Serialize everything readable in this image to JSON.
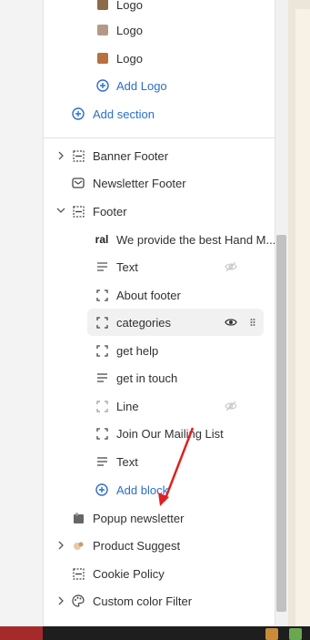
{
  "sidebar": {
    "logo_items": [
      {
        "label": "Logo"
      },
      {
        "label": "Logo"
      },
      {
        "label": "Logo"
      }
    ],
    "add_logo": "Add Logo",
    "add_section": "Add section",
    "sections": [
      {
        "label": "Banner Footer",
        "icon": "layout-icon"
      },
      {
        "label": "Newsletter Footer",
        "icon": "envelope-icon"
      },
      {
        "label": "Footer",
        "icon": "layout-icon"
      }
    ],
    "footer_blocks": [
      {
        "label": "We provide the best Hand M...",
        "icon": "heading-icon",
        "icon_text": "ral"
      },
      {
        "label": "Text",
        "icon": "text-icon"
      },
      {
        "label": "About footer",
        "icon": "dashed-square-icon"
      },
      {
        "label": "categories",
        "icon": "dashed-square-icon"
      },
      {
        "label": "get help",
        "icon": "dashed-square-icon"
      },
      {
        "label": "get in touch",
        "icon": "text-icon"
      },
      {
        "label": "Line",
        "icon": "dashed-square-icon"
      },
      {
        "label": "Join Our Mailing List",
        "icon": "dashed-square-icon"
      },
      {
        "label": "Text",
        "icon": "text-icon"
      }
    ],
    "add_block": "Add block",
    "bottom_sections": [
      {
        "label": "Popup newsletter",
        "icon": "popup-icon"
      },
      {
        "label": "Product Suggest",
        "icon": "product-icon"
      },
      {
        "label": "Cookie Policy",
        "icon": "layout-icon"
      },
      {
        "label": "Custom color Filter",
        "icon": "palette-icon"
      }
    ]
  },
  "colors": {
    "accent": "#2c6ecb",
    "annotation_arrow": "#e02020"
  }
}
